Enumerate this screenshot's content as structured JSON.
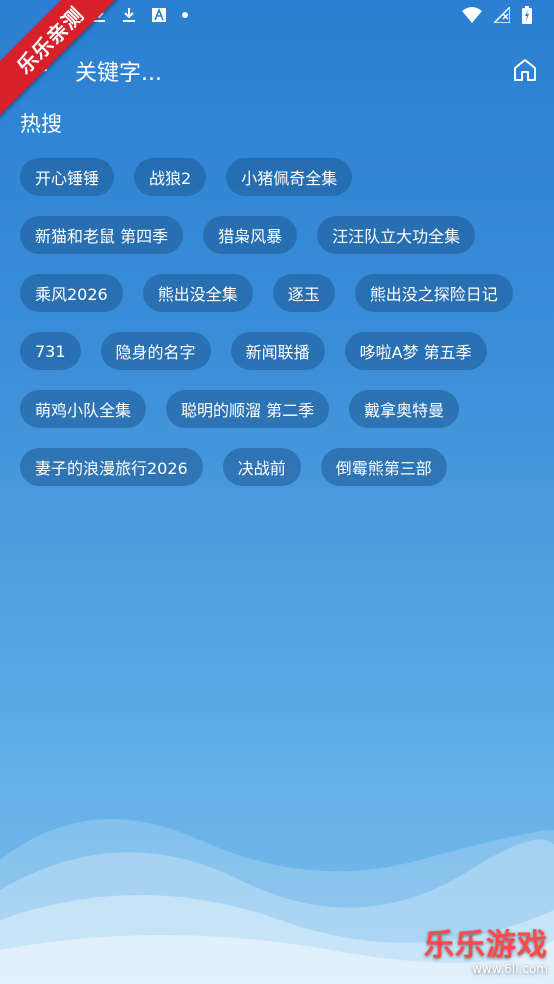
{
  "ribbon": {
    "text": "乐乐亲测"
  },
  "status_bar": {
    "icons": [
      "download-icon",
      "download-icon",
      "a-icon",
      "dot-icon",
      "wifi-icon",
      "no-signal-icon",
      "battery-charging-icon"
    ]
  },
  "app_bar": {
    "title": "关键字...",
    "back_icon": "back-arrow-icon",
    "home_icon": "home-icon"
  },
  "hot_search": {
    "title": "热搜",
    "rows": [
      [
        "开心锤锤",
        "战狼2",
        "小猪佩奇全集"
      ],
      [
        "新猫和老鼠 第四季",
        "猎枭风暴",
        "汪汪队立大功全集"
      ],
      [
        "乘风2026",
        "熊出没全集",
        "逐玉",
        "熊出没之探险日记"
      ],
      [
        "731",
        "隐身的名字",
        "新闻联播",
        "哆啦A梦 第五季"
      ],
      [
        "萌鸡小队全集",
        "聪明的顺溜 第二季",
        "戴拿奥特曼"
      ],
      [
        "妻子的浪漫旅行2026",
        "决战前",
        "倒霉熊第三部"
      ]
    ]
  },
  "watermark": {
    "title": "乐乐游戏",
    "url": "www.6ll.com"
  },
  "colors": {
    "tag_bg": "#2a6aa6",
    "ribbon": "#d8202a",
    "bg_top": "#2a7fd2",
    "bg_bottom": "#7cc0ee"
  }
}
